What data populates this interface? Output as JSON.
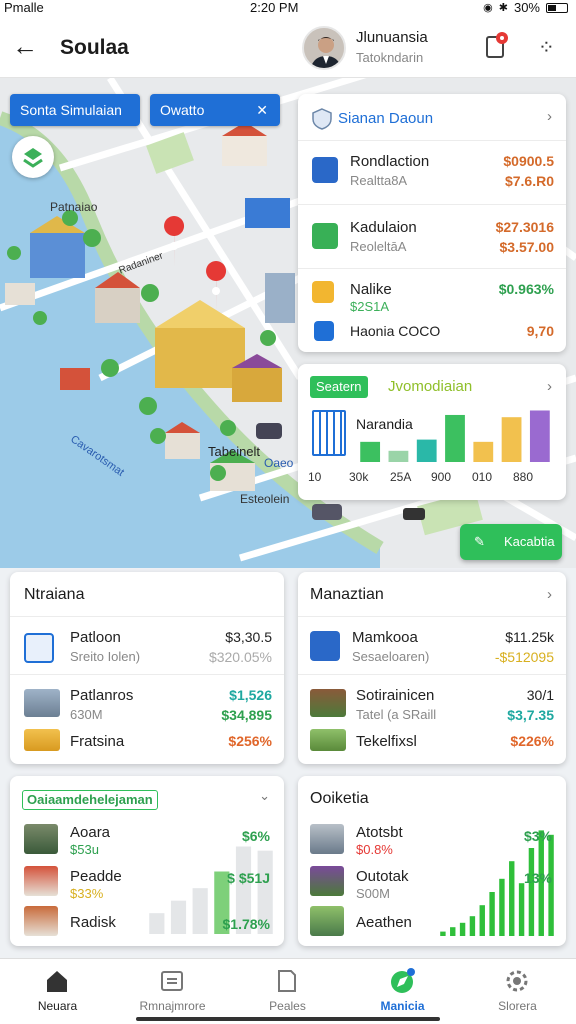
{
  "status": {
    "carrier": "Pmalle",
    "time": "2:20 PM",
    "battery": "30%"
  },
  "header": {
    "title": "Soulaa",
    "user_name": "Jlunuansia",
    "user_sub": "Tatokndarin"
  },
  "map": {
    "buttons": {
      "simulation": "Sonta Simulaian",
      "filter": "Owatto"
    },
    "labels": {
      "a": "Patnaiao",
      "b": "Tabeinelt",
      "c": "Oaeo",
      "d": "Esteolein",
      "e": "Radaniner",
      "f": "Cavarotsmat"
    },
    "action_label": "Kacabtia"
  },
  "sim_card": {
    "title": "Sianan Daoun",
    "rows": [
      {
        "name": "Rondlaction",
        "sub": "Realtta8A",
        "value": "$0900.5",
        "value2": "$7.6.R0"
      },
      {
        "name": "Kadulaion",
        "sub": "ReoleltāA",
        "value": "$27.3016",
        "value2": "$3.57.00"
      },
      {
        "name": "Nalike",
        "sub": "$2S1A",
        "value": "$0.963%"
      },
      {
        "name": "Haonia COCO",
        "value": "9,70"
      }
    ]
  },
  "chart_card": {
    "tag": "Seatern",
    "title": "Jvomodiaian",
    "caption": "Narandia",
    "chart_data": {
      "type": "bar",
      "categories": [
        "10",
        "30k",
        "25A",
        "900",
        "010",
        "880"
      ],
      "values": [
        18,
        10,
        20,
        42,
        18,
        40,
        46
      ],
      "ylim": [
        0,
        50
      ],
      "colors": [
        "#3cc060",
        "#9ad4a8",
        "#2ab8a8",
        "#3cc060",
        "#f2c14e",
        "#f2c14e",
        "#9a6ad0"
      ]
    }
  },
  "panel_left": {
    "title": "Ntraiana",
    "rows": [
      {
        "name": "Patloon",
        "sub": "Sreito Iolen)",
        "value": "$3,30.5",
        "value2": "$320.05%"
      },
      {
        "name": "Patlanros",
        "sub": "630M",
        "value": "$1,526",
        "value2": "$34,895"
      },
      {
        "name": "Fratsina",
        "value": "$256%"
      }
    ]
  },
  "panel_right": {
    "title": "Manaztian",
    "rows": [
      {
        "name": "Mamkooa",
        "sub": "Sesaeloaren)",
        "value": "$11.25k",
        "value2": "-$512095"
      },
      {
        "name": "Sotirainicen",
        "sub": "Tatel (a SRaill",
        "value": "30/1",
        "value2": "$3,7.35"
      },
      {
        "name": "Tekelfixsl",
        "value": "$226%"
      }
    ]
  },
  "perf_left": {
    "title": "Oaiaamdehelejaman",
    "rows": [
      {
        "name": "Aoara",
        "sub": "$53u",
        "value": "$6%"
      },
      {
        "name": "Peadde",
        "sub": "$33%",
        "value": "$ $51J"
      },
      {
        "name": "Radisk",
        "value": "$1.78%"
      }
    ],
    "chart_data": {
      "type": "bar",
      "values": [
        10,
        16,
        22,
        30,
        42,
        40
      ],
      "ylim": [
        0,
        48
      ],
      "highlight_index": 3
    }
  },
  "perf_right": {
    "title": "Ooiketia",
    "rows": [
      {
        "name": "Atotsbt",
        "sub": "$0.8%",
        "value": "$3%"
      },
      {
        "name": "Outotak",
        "sub": "S00M",
        "value": "13%"
      },
      {
        "name": "Aeathen",
        "value": "—"
      }
    ],
    "chart_data": {
      "type": "bar",
      "values": [
        2,
        4,
        6,
        9,
        14,
        20,
        26,
        34,
        24,
        40,
        48,
        46
      ],
      "ylim": [
        0,
        50
      ]
    }
  },
  "nav": [
    {
      "label": "Neuara",
      "icon": "home-icon"
    },
    {
      "label": "Rmnajmrore",
      "icon": "news-icon"
    },
    {
      "label": "Peales",
      "icon": "document-icon"
    },
    {
      "label": "Manicia",
      "icon": "compass-icon",
      "active": true
    },
    {
      "label": "Slorera",
      "icon": "settings-icon"
    }
  ]
}
